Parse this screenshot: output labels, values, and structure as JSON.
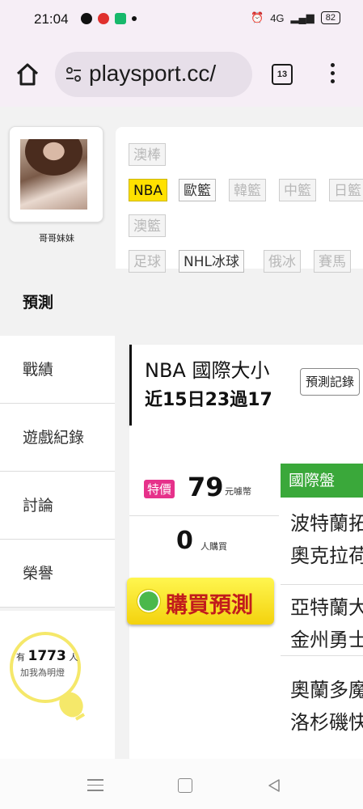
{
  "status_bar": {
    "time": "21:04",
    "network": "4G",
    "battery": "82"
  },
  "browser": {
    "url": "playsport.cc/",
    "tab_count": "13"
  },
  "profile": {
    "username": "哥哥妹妹"
  },
  "nav": {
    "active": "預測",
    "items": [
      "戰績",
      "遊戲紀錄",
      "討論",
      "榮譽"
    ],
    "fans_prefix": "有",
    "fans_count": "1773",
    "fans_suffix": "人",
    "fans_note": "加我為明燈"
  },
  "categories": {
    "row1": [
      "澳棒"
    ],
    "row2": [
      "NBA",
      "歐籃",
      "韓籃",
      "中籃",
      "日籃"
    ],
    "row3": [
      "澳籃"
    ],
    "row4": [
      "足球",
      "NHL冰球",
      "俄冰",
      "賽馬"
    ],
    "active": "NBA"
  },
  "game": {
    "title": "NBA 國際大小",
    "record_button": "預測記錄",
    "summary": "近15日23過17"
  },
  "purchase": {
    "badge": "特價",
    "price": "79",
    "price_unit": "元噱幣",
    "buyers": "0",
    "buyers_unit": "人購買",
    "buy_button": "購買預測"
  },
  "market": {
    "header": "國際盤",
    "matches": [
      {
        "home": "波特蘭拓荒者",
        "away": "奧克拉荷馬雷霆"
      },
      {
        "home": "亞特蘭大老鷹",
        "away": "金州勇士"
      },
      {
        "home": "奧蘭多魔術",
        "away": "洛杉磯快艇"
      }
    ]
  },
  "colors": {
    "active_tag": "#ffe100",
    "market_header": "#3aa83a",
    "sale_badge": "#e6318a",
    "buy_button": "#f3d20e",
    "buy_text": "#c21c1c"
  }
}
